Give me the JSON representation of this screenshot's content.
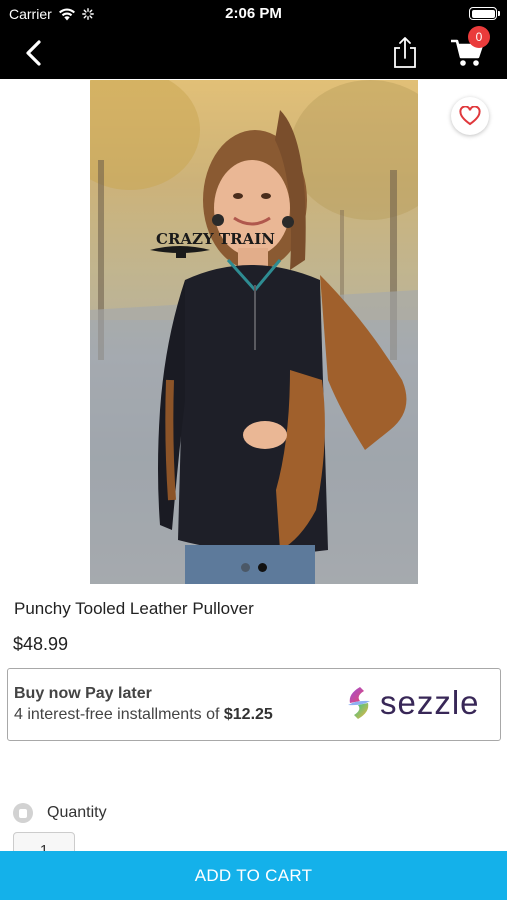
{
  "status_bar": {
    "carrier": "Carrier",
    "time": "2:06 PM"
  },
  "nav": {
    "cart_count": "0"
  },
  "product": {
    "image_watermark": "CRAZY TRAIN",
    "title": "Punchy Tooled Leather Pullover",
    "price": "$48.99",
    "image_count": 2,
    "active_image": 2
  },
  "sezzle": {
    "headline": "Buy now Pay later",
    "installments_prefix": "4 interest-free installments of ",
    "installment_amount": "$12.25",
    "brand": "sezzle"
  },
  "quantity": {
    "label": "Quantity",
    "value": "1"
  },
  "add_to_cart_label": "ADD TO CART",
  "colors": {
    "accent": "#14b1ea",
    "badge": "#ea3b3b",
    "sezzle_text": "#382757"
  }
}
